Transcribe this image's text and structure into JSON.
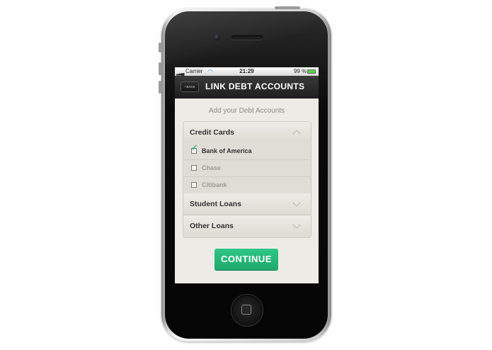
{
  "status_bar": {
    "carrier": "Carrier",
    "time": "21:29",
    "battery_text": "99 %",
    "battery_level_percent": 99
  },
  "nav": {
    "back_label": "BACK",
    "title": "LINK DEBT ACCOUNTS"
  },
  "main": {
    "section_title": "Add your Debt Accounts",
    "groups": [
      {
        "label": "Credit Cards",
        "expanded": true,
        "items": [
          {
            "label": "Bank of America",
            "checked": true
          },
          {
            "label": "Chase",
            "checked": false
          },
          {
            "label": "Citibank",
            "checked": false
          }
        ]
      },
      {
        "label": "Student Loans",
        "expanded": false
      },
      {
        "label": "Other Loans",
        "expanded": false
      }
    ],
    "continue_label": "CONTINUE"
  },
  "colors": {
    "accent_green": "#23b574",
    "navbar_dark": "#2a2a2a",
    "screen_bg": "#ecebe6"
  },
  "icons": {
    "back": "chevron-left-icon",
    "expanded": "chevron-up-icon",
    "collapsed": "chevron-down-icon",
    "checked": "checkmark-icon"
  }
}
